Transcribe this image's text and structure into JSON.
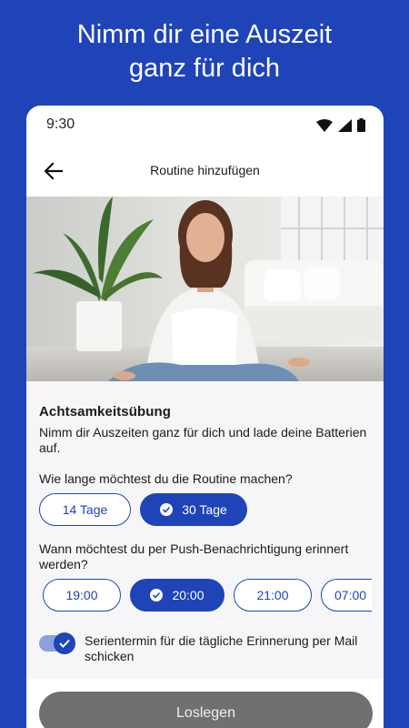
{
  "headline": {
    "line1": "Nimm dir eine Auszeit",
    "line2": "ganz für dich"
  },
  "status_bar": {
    "time": "9:30"
  },
  "app_bar": {
    "title": "Routine hinzufügen"
  },
  "exercise": {
    "title": "Achtsamkeitsübung",
    "description": "Nimm dir Auszeiten ganz für dich und lade deine Batterien auf."
  },
  "duration": {
    "question": "Wie lange möchtest du die Routine machen?",
    "options": [
      {
        "label": "14 Tage",
        "selected": false
      },
      {
        "label": "30 Tage",
        "selected": true
      }
    ]
  },
  "reminder": {
    "question": "Wann möchtest du per Push-Benachrichtigung erinnert werden?",
    "options": [
      {
        "label": "19:00",
        "selected": false
      },
      {
        "label": "20:00",
        "selected": true
      },
      {
        "label": "21:00",
        "selected": false
      },
      {
        "label": "07:00",
        "selected": false
      }
    ]
  },
  "mail_option": {
    "label": "Serientermin für die tägliche Erinnerung per Mail schicken",
    "checked": true
  },
  "cta": {
    "label": "Loslegen"
  },
  "colors": {
    "brand_blue": "#1e44b8",
    "button_gray": "#707070"
  }
}
